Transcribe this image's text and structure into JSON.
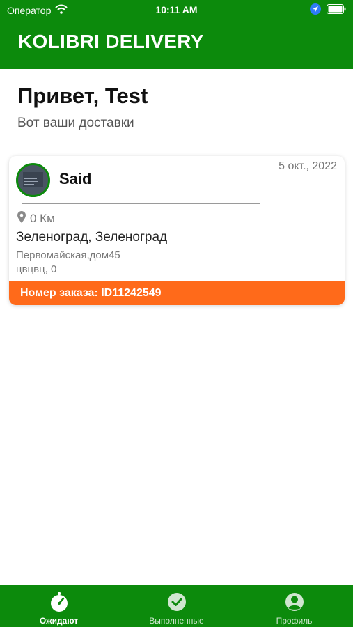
{
  "status_bar": {
    "carrier": "Оператор",
    "time": "10:11 AM",
    "icons": [
      "wifi-icon",
      "location-arrow-icon",
      "battery-icon"
    ]
  },
  "app": {
    "brand": "KOLIBRI DELIVERY",
    "colors": {
      "primary": "#0c8a0c",
      "accent": "#ff6a1a"
    }
  },
  "header": {
    "greeting": "Привет, Test",
    "subtitle": "Вот ваши доставки"
  },
  "deliveries": [
    {
      "name": "Said",
      "date": "5 окт., 2022",
      "distance": "0 Км",
      "city": "Зеленоград, Зеленоград",
      "street": "Первомайская,дом45",
      "apartment": "цвцвц, 0",
      "order_label": "Номер заказа: ID11242549"
    }
  ],
  "tabbar": {
    "tabs": [
      {
        "label": "Ожидают",
        "icon": "stopwatch-icon",
        "active": true
      },
      {
        "label": "Выполненные",
        "icon": "check-circle-icon",
        "active": false
      },
      {
        "label": "Профиль",
        "icon": "profile-icon",
        "active": false
      }
    ]
  }
}
